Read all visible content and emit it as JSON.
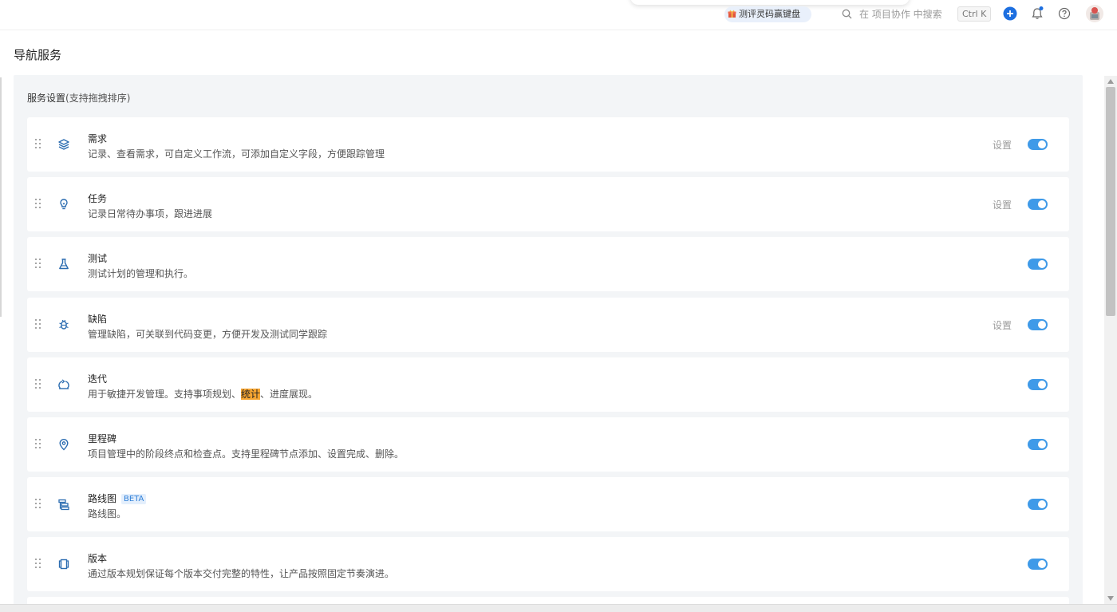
{
  "topbar": {
    "promo_label": "测评灵码赢键盘",
    "search_placeholder": "在 项目协作 中搜索",
    "shortcut": "Ctrl K",
    "icons": [
      "gift-icon",
      "search-icon",
      "plus-icon",
      "bell-icon",
      "help-icon",
      "avatar"
    ]
  },
  "page": {
    "title": "导航服务",
    "section_title": "服务设置",
    "section_hint": "(支持拖拽排序)"
  },
  "services": [
    {
      "icon": "layers-icon",
      "name": "需求",
      "desc": "记录、查看需求，可自定义工作流，可添加自定义字段，方便跟踪管理",
      "settings": "设置",
      "enabled": true
    },
    {
      "icon": "lightbulb-icon",
      "name": "任务",
      "desc": "记录日常待办事项，跟进进展",
      "settings": "设置",
      "enabled": true
    },
    {
      "icon": "flask-icon",
      "name": "测试",
      "desc": "测试计划的管理和执行。",
      "settings": "",
      "enabled": true
    },
    {
      "icon": "bug-icon",
      "name": "缺陷",
      "desc": "管理缺陷，可关联到代码变更，方便开发及测试同学跟踪",
      "settings": "设置",
      "enabled": true
    },
    {
      "icon": "cycle-icon",
      "name": "迭代",
      "desc_before": "用于敏捷开发管理。支持事项规划、",
      "desc_highlight": "统计",
      "desc_after": "、进度展现。",
      "settings": "",
      "enabled": true
    },
    {
      "icon": "location-pin-icon",
      "name": "里程碑",
      "desc": "项目管理中的阶段终点和检查点。支持里程碑节点添加、设置完成、删除。",
      "settings": "",
      "enabled": true
    },
    {
      "icon": "roadmap-icon",
      "name": "路线图",
      "badge": "BETA",
      "desc": "路线图。",
      "settings": "",
      "enabled": true
    },
    {
      "icon": "version-book-icon",
      "name": "版本",
      "desc": "通过版本规划保证每个版本交付完整的特性，让产品按照固定节奏演进。",
      "settings": "",
      "enabled": true
    }
  ],
  "colors": {
    "accent": "#3f9ae8",
    "highlight": "#f7a531",
    "panel_bg": "#f3f5f7"
  }
}
